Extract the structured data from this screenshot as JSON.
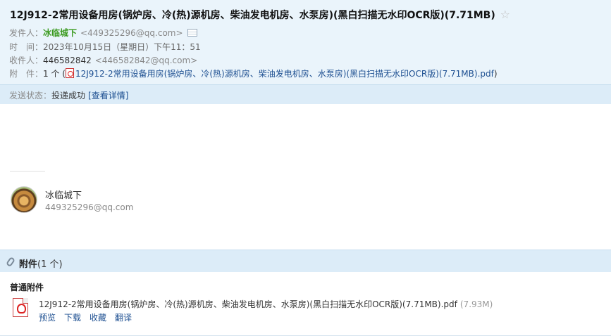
{
  "mail": {
    "subject": "12J912-2常用设备用房(锅炉房、冷(热)源机房、柴油发电机房、水泵房)(黑白扫描无水印OCR版)(7.71MB)",
    "star": "☆",
    "sender_label": "发件人：",
    "sender_name": "冰临城下",
    "sender_email": "<449325296@qq.com>",
    "time_label": "时　间：",
    "time_value": "2023年10月15日（星期日）下午11：51",
    "recipient_label": "收件人：",
    "recipient_name": "446582842",
    "recipient_email": "<446582842@qq.com>",
    "attach_label": "附　件：",
    "attach_count": "1 个 (",
    "attach_link": "12J912-2常用设备用房(锅炉房、冷(热)源机房、柴油发电机房、水泵房)(黑白扫描无水印OCR版)(7.71MB).pdf",
    "attach_close": ")"
  },
  "status": {
    "label": "发送状态：",
    "value": "投递成功",
    "detail": "[查看详情]"
  },
  "signature": {
    "name": "冰临城下",
    "email": "449325296@qq.com"
  },
  "attachments": {
    "title": "附件",
    "count": "(1 个)",
    "group": "普通附件",
    "file_name": "12J912-2常用设备用房(锅炉房、冷(热)源机房、柴油发电机房、水泵房)(黑白扫描无水印OCR版)(7.71MB).pdf",
    "file_size": "(7.93M)",
    "actions": {
      "preview": "预览",
      "download": "下载",
      "favorite": "收藏",
      "translate": "翻译"
    }
  },
  "icons": {
    "star": "star-icon",
    "card": "contact-card-icon",
    "pdf": "pdf-icon",
    "clip": "paperclip-icon"
  }
}
